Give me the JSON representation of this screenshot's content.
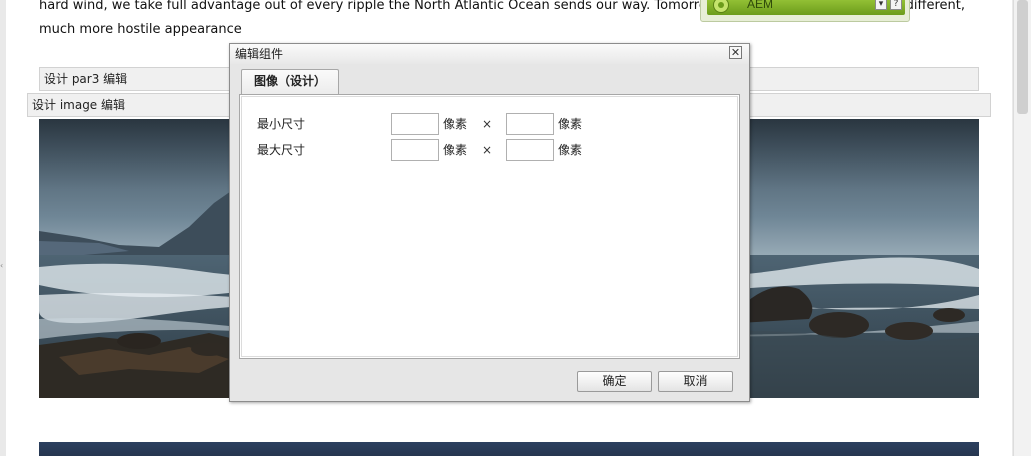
{
  "article": {
    "lines": [
      "hard wind, we take full advantage out of every ripple the North Atlantic Ocean sends our way. Tomorrow this place may look entirely different,",
      "much more hostile appearance"
    ]
  },
  "edit_bars": {
    "par3": "设计 par3 编辑",
    "image": "设计 image 编辑"
  },
  "sidekick": {
    "title": "AEM",
    "menu_glyph": "▾",
    "help_glyph": "?"
  },
  "dialog": {
    "title": "编辑组件",
    "close_glyph": "✕",
    "tab_label": "图像（设计）",
    "rows": [
      {
        "label": "最小尺寸",
        "width_value": "",
        "height_value": "",
        "unit": "像素",
        "separator": "×"
      },
      {
        "label": "最大尺寸",
        "width_value": "",
        "height_value": "",
        "unit": "像素",
        "separator": "×"
      }
    ],
    "ok_label": "确定",
    "cancel_label": "取消"
  },
  "colors": {
    "sidekick_green": "#7cad24",
    "dialog_bg": "#e6e6e6",
    "banner_navy": "#2a3b57"
  },
  "icons": {
    "sidekick_logo": "aem-logo-icon",
    "dialog_close": "close-icon",
    "sidekick_menu": "chevron-down-icon",
    "sidekick_help": "help-icon"
  }
}
